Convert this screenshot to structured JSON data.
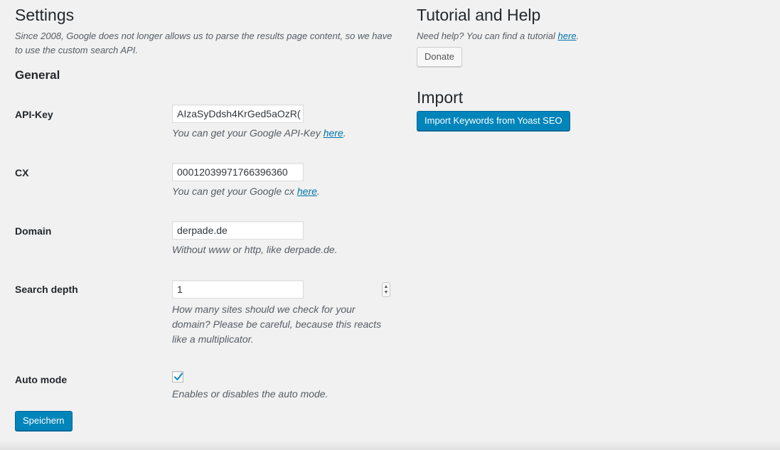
{
  "settings": {
    "title": "Settings",
    "intro": "Since 2008, Google does not longer allows us to parse the results page content, so we have to use the custom search API.",
    "general_heading": "General",
    "fields": {
      "api_key": {
        "label": "API-Key",
        "value": "AIzaSyDdsh4KrGed5aOzR(",
        "hint_prefix": "You can get your Google API-Key ",
        "hint_link": "here",
        "hint_suffix": "."
      },
      "cx": {
        "label": "CX",
        "value": "00012039971766396360",
        "hint_prefix": "You can get your Google cx ",
        "hint_link": "here",
        "hint_suffix": "."
      },
      "domain": {
        "label": "Domain",
        "value": "derpade.de",
        "hint": "Without www or http, like derpade.de."
      },
      "search_depth": {
        "label": "Search depth",
        "value": "1",
        "hint": "How many sites should we check for your domain? Please be careful, because this reacts like a multiplicator."
      },
      "auto_mode": {
        "label": "Auto mode",
        "checked": true,
        "hint": "Enables or disables the auto mode."
      }
    },
    "save_label": "Speichern"
  },
  "help": {
    "title": "Tutorial and Help",
    "text_prefix": "Need help? You can find a tutorial ",
    "link": "here",
    "text_suffix": ".",
    "donate_label": "Donate"
  },
  "import": {
    "title": "Import",
    "button_label": "Import Keywords from Yoast SEO"
  },
  "colors": {
    "background": "#f1f1f1",
    "primary_button": "#0085ba",
    "link": "#0073aa",
    "checkmark": "#1e8cbe"
  },
  "icons": {
    "checkbox_mark": "checkmark-icon",
    "spinner": "number-spinner-icon"
  }
}
